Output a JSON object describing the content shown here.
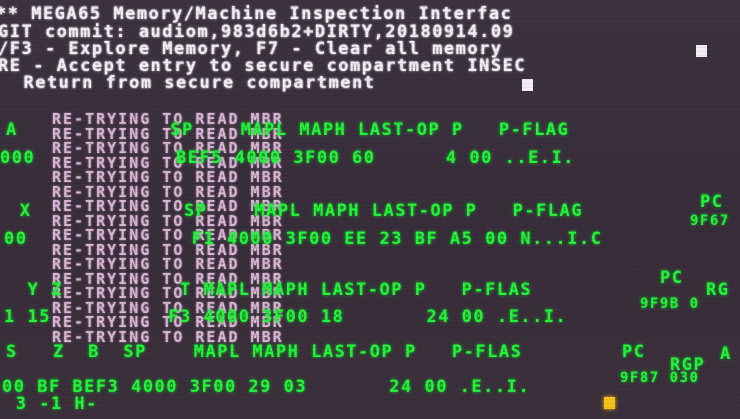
{
  "header": {
    "line1": "** MEGA65 Memory/Machine Inspection Interfac",
    "line2": "GIT commit: audiom,983d6b2+DIRTY,20180914.09",
    "line3": "/F3 - Explore Memory, F7 - Clear all memory",
    "line4": "RE - Accept entry to secure compartment INSEC",
    "line5": "  Return from secure compartment"
  },
  "retry_lines": [
    "RE-TRYING TO READ MBR",
    "RE-TRYING TO READ MBR",
    "RE-TRYING TO READ MBR",
    "RE-TRYING TO READ MBR",
    "RE-TRYING TO READ MBR",
    "RE-TRYING TO READ MBR",
    "RE-TRYING TO READ MBR",
    "RE-TRYING TO READ MBR",
    "RE-TRYING TO READ MBR",
    "RE-TRYING TO READ MBR",
    "RE-TRYING TO READ MBR",
    "RE-TRYING TO READ MBR",
    "RE-TRYING TO READ MBR",
    "RE-TRYING TO READ MBR",
    "RE-TRYING TO READ MBR",
    "RE-TRYING TO READ MBR"
  ],
  "monitor": {
    "block1_header": "A             SP    MAPL MAPH LAST-OP P   P-FLAG",
    "block1_values": "000            BEF5 4000 3F00 60      4 00 ..E.I.",
    "block2_header": " X             SP    MAPL MAPH LAST-OP P   P-FLAG",
    "block2_pc": "PC",
    "block2_values": "00              F1 4000 3F00 EE 23 BF A5 00 N...I.C",
    "block3_header": "  Y Z          T MAPL MAPH LAST-OP P   P-FLAS",
    "block3_pc": "PC",
    "block3_values": "1 15          F3 4000 3F00 18       24 00 .E..I.",
    "block4_header": "S   Z  B  SP    MAPL MAPH LAST-OP P   P-FLAS",
    "block4_pc": "PC",
    "block4_values": "00 BF BEF3 4000 3F00 29 03       24 00 .E..I.",
    "block4_sub": " 3 -1 H-",
    "rgp_a": "RG",
    "rgp_b": "RGP",
    "addr_a": "9F67",
    "addr_b": "9F9B 0",
    "addr_c": "9F87 030",
    "misc_a": "A"
  }
}
